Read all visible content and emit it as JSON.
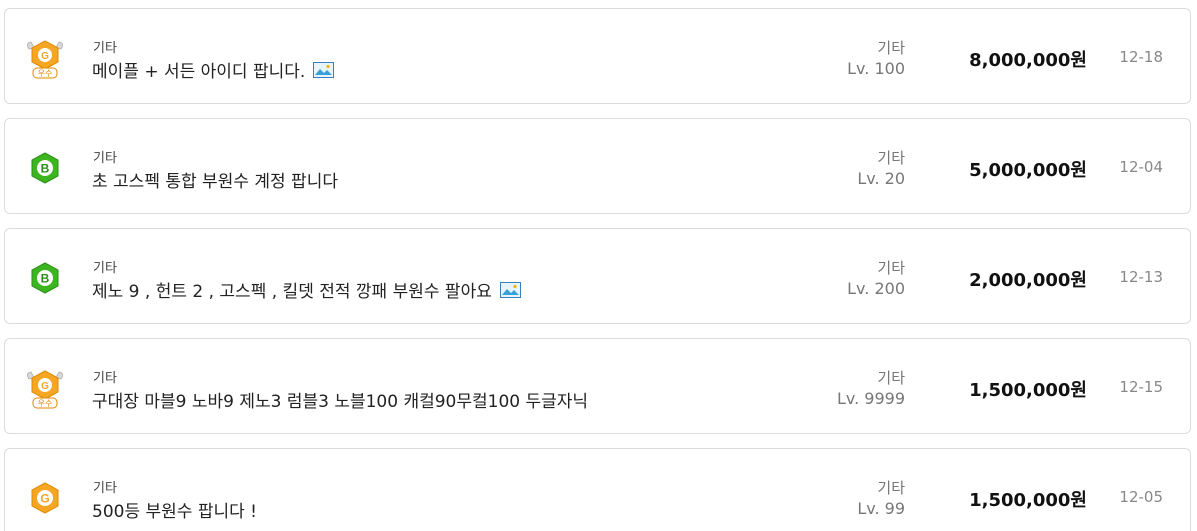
{
  "listings": [
    {
      "badge": "gold-premium-badge",
      "badge_text": "우수",
      "category": "기타",
      "title": "메이플 + 서든 아이디 팝니다.",
      "has_image": true,
      "server": "기타",
      "level": "Lv. 100",
      "price": "8,000,000원",
      "date": "12-18"
    },
    {
      "badge": "green-b-badge",
      "category": "기타",
      "title": "초 고스펙 통합 부원수 계정 팝니다",
      "has_image": false,
      "server": "기타",
      "level": "Lv. 20",
      "price": "5,000,000원",
      "date": "12-04"
    },
    {
      "badge": "green-b-badge",
      "category": "기타",
      "title": "제노 9 , 헌트 2 , 고스펙 , 킬뎃 전적 깡패 부원수 팔아요",
      "has_image": true,
      "server": "기타",
      "level": "Lv. 200",
      "price": "2,000,000원",
      "date": "12-13"
    },
    {
      "badge": "gold-premium-badge",
      "badge_text": "우수",
      "category": "기타",
      "title": "구대장 마블9 노바9 제노3 럼블3 노블100 캐컬90무컬100 두글자닉",
      "has_image": false,
      "server": "기타",
      "level": "Lv. 9999",
      "price": "1,500,000원",
      "date": "12-15"
    },
    {
      "badge": "gold-g-badge",
      "category": "기타",
      "title": "500등 부원수 팝니다 !",
      "has_image": false,
      "server": "기타",
      "level": "Lv. 99",
      "price": "1,500,000원",
      "date": "12-05"
    }
  ]
}
